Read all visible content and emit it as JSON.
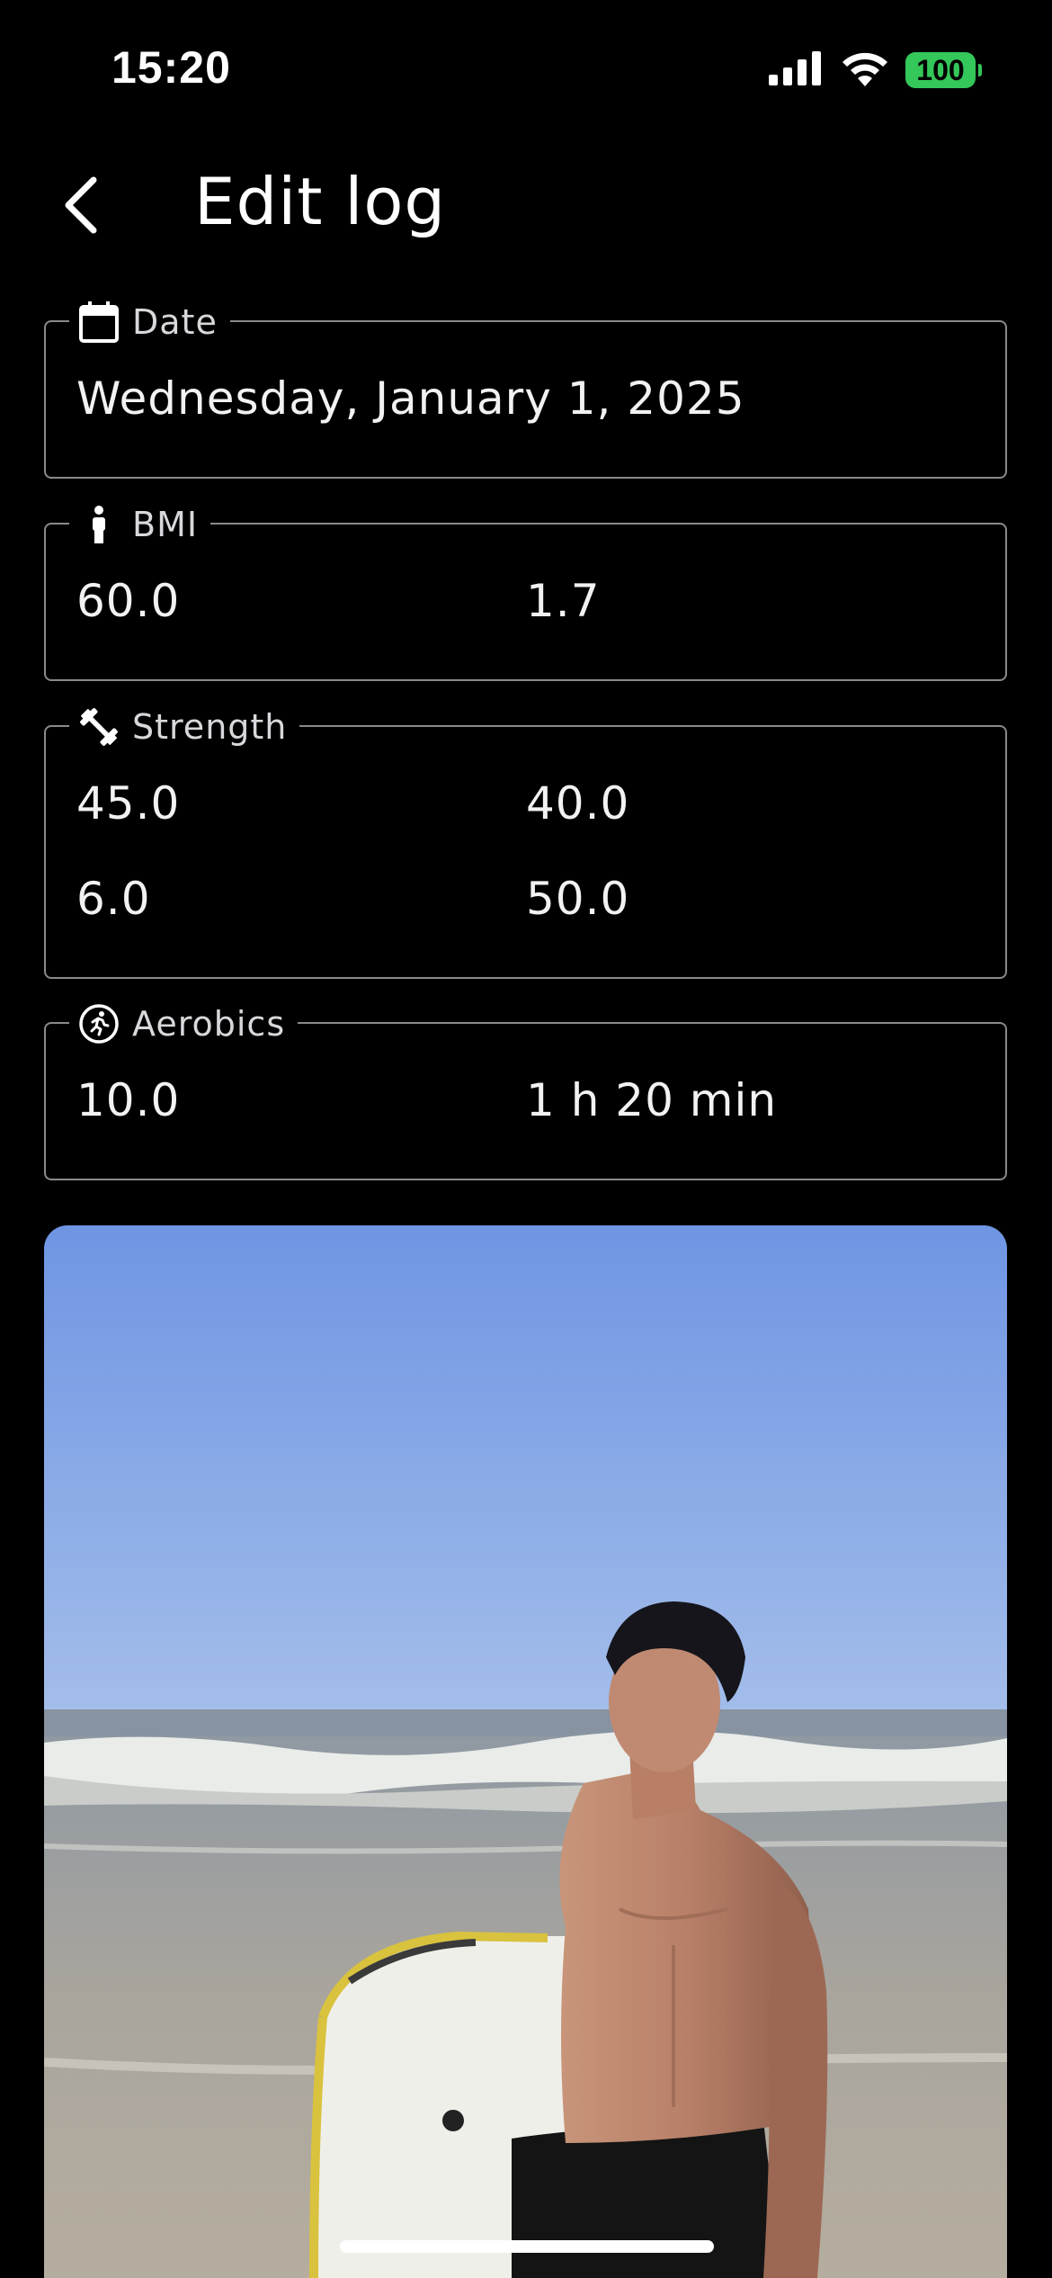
{
  "status_bar": {
    "time": "15:20",
    "battery": "100",
    "icons": [
      "signal-icon",
      "wifi-icon",
      "battery-icon"
    ]
  },
  "header": {
    "title": "Edit log",
    "back_icon": "chevron-left-icon"
  },
  "date_card": {
    "label": "Date",
    "icon": "calendar-icon",
    "value": "Wednesday, January 1, 2025"
  },
  "bmi_card": {
    "label": "BMI",
    "icon": "person-icon",
    "weight": "60.0",
    "height": "1.7"
  },
  "strength_card": {
    "label": "Strength",
    "icon": "dumbbell-icon",
    "values": [
      "45.0",
      "40.0",
      "6.0",
      "50.0"
    ]
  },
  "aerobics_card": {
    "label": "Aerobics",
    "icon": "running-icon",
    "distance": "10.0",
    "duration": "1 h 20 min"
  },
  "photo": {
    "subject": "beach-photo"
  },
  "colors": {
    "background": "#000000",
    "border": "#8a8a8e",
    "battery": "#34c759",
    "text": "#ffffff"
  }
}
